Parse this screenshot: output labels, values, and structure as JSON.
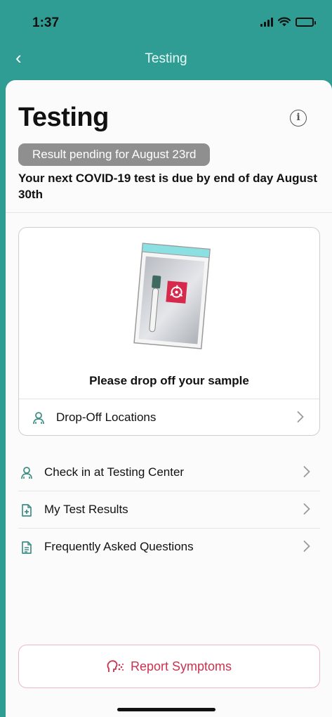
{
  "status_bar": {
    "time": "1:37"
  },
  "nav": {
    "title": "Testing",
    "back_glyph": "‹"
  },
  "page": {
    "title": "Testing",
    "info_glyph": "i",
    "status_badge": "Result pending for August 23rd",
    "due_text": "Your next COVID-19 test is due by end of day August 30th"
  },
  "sample_card": {
    "caption": "Please drop off your sample",
    "action": {
      "label": "Drop-Off Locations",
      "icon": "location-person-icon"
    }
  },
  "menu": [
    {
      "label": "Check in at Testing Center",
      "icon": "person-check-icon"
    },
    {
      "label": "My Test Results",
      "icon": "medical-document-icon"
    },
    {
      "label": "Frequently Asked Questions",
      "icon": "document-icon"
    }
  ],
  "report": {
    "label": "Report Symptoms",
    "icon": "cough-icon"
  },
  "colors": {
    "header": "#2f9d94",
    "accent_icon": "#3f8f86",
    "badge": "#8f8f8f",
    "report_text": "#c8334f",
    "report_border": "#efb9c4",
    "biohazard": "#d6294b"
  }
}
